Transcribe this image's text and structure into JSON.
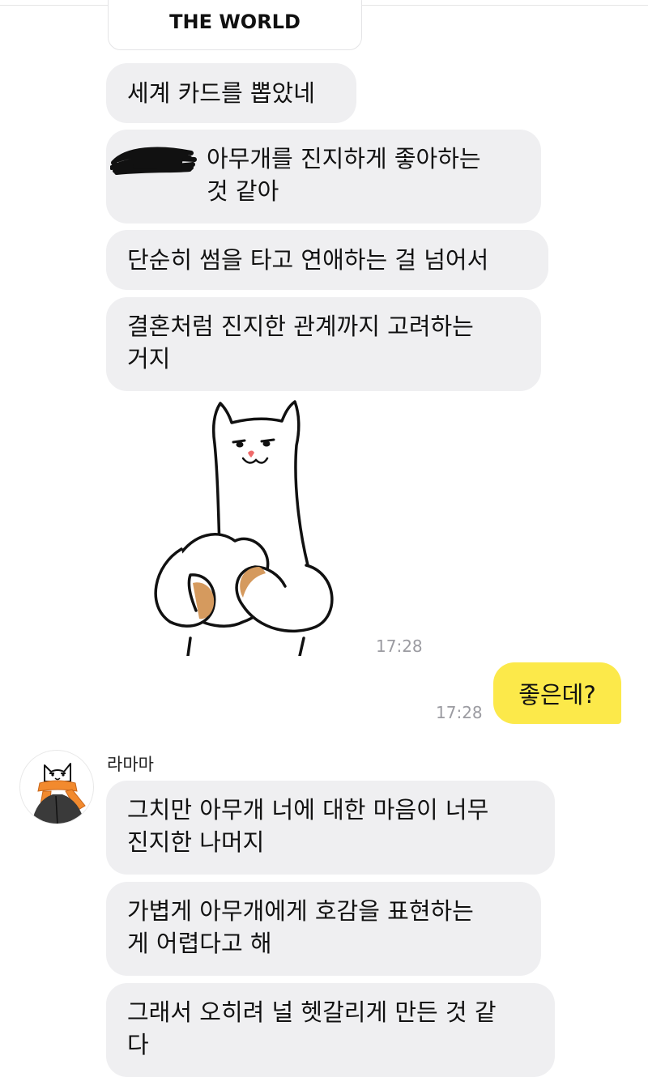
{
  "card": {
    "title": "THE WORLD"
  },
  "messages_partner_1": [
    "세계 카드를 뽑았네",
    "아무개를 진지하게 좋아하는\n것 같아",
    "단순히 썸을 타고 연애하는 걸 넘어서",
    "결혼처럼 진지한 관계까지 고려하는\n거지"
  ],
  "sticker": {
    "icon": "cat-sticker",
    "time": "17:28"
  },
  "my_message": {
    "text": "좋은데?",
    "time": "17:28"
  },
  "partner": {
    "name": "라마마",
    "avatar_icon": "cat-avatar"
  },
  "messages_partner_2": [
    "그치만 아무개 너에 대한 마음이 너무\n진지한 나머지",
    "가볍게 아무개에게 호감을 표현하는\n게 어렵다고 해",
    "그래서 오히려 널 헷갈리게 만든 것 같\n다"
  ],
  "colors": {
    "partner_bubble": "#efeff1",
    "my_bubble": "#fce94a",
    "timestamp": "#9b9ba1",
    "scarf_orange": "#f28a2e"
  }
}
